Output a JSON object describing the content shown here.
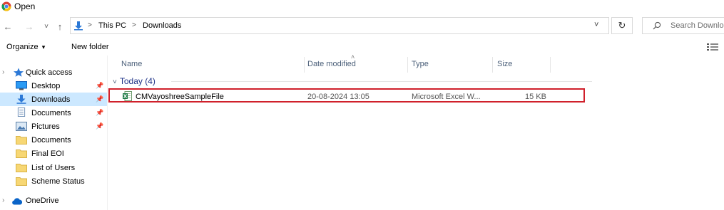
{
  "window": {
    "title": "Open"
  },
  "navigation": {
    "back_glyph": "←",
    "forward_glyph": "→",
    "recent_glyph": "˅",
    "up_glyph": "↑",
    "breadcrumbs": [
      "This PC",
      "Downloads"
    ],
    "separator": ">",
    "dropdown_glyph": "˅",
    "refresh_glyph": "↻",
    "search_placeholder": "Search Downloads"
  },
  "toolbar": {
    "organize_label": "Organize",
    "organize_caret": "▾",
    "new_folder_label": "New folder"
  },
  "sidebar": {
    "items": [
      {
        "label": "Quick access",
        "icon": "star-icon",
        "expander": "›"
      },
      {
        "label": "Desktop",
        "icon": "desktop-icon",
        "pinned": true
      },
      {
        "label": "Downloads",
        "icon": "download-icon",
        "pinned": true,
        "selected": true
      },
      {
        "label": "Documents",
        "icon": "documents-icon",
        "pinned": true
      },
      {
        "label": "Pictures",
        "icon": "pictures-icon",
        "pinned": true
      },
      {
        "label": "Documents",
        "icon": "folder-icon"
      },
      {
        "label": "Final EOI",
        "icon": "folder-icon"
      },
      {
        "label": "List of Users",
        "icon": "folder-icon"
      },
      {
        "label": "Scheme Status",
        "icon": "folder-icon"
      },
      {
        "label": "OneDrive",
        "icon": "cloud-icon",
        "expander": "›"
      }
    ],
    "pin_glyph": "📌"
  },
  "columns": {
    "name": "Name",
    "date_modified": "Date modified",
    "type": "Type",
    "size": "Size",
    "sort_glyph": "˄"
  },
  "group": {
    "label": "Today (4)",
    "toggle_glyph": "˅"
  },
  "files": [
    {
      "name": "CMVayoshreeSampleFile",
      "date_modified": "20-08-2024 13:05",
      "type": "Microsoft Excel W...",
      "size": "15 KB",
      "icon": "excel-file-icon",
      "highlighted": true
    }
  ],
  "colors": {
    "selected_bg": "#cce8ff",
    "highlight_border": "#d0202b",
    "group_text": "#1e3287",
    "column_text": "#4c607a"
  }
}
